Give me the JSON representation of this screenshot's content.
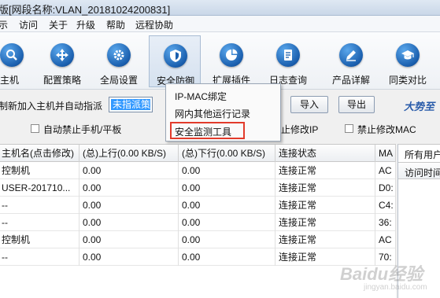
{
  "window": {
    "title": "版[网段名称:VLAN_20181024200831]"
  },
  "menu": [
    "示",
    "访问",
    "关于",
    "升级",
    "帮助",
    "远程协助"
  ],
  "toolbar": [
    {
      "label": "主机",
      "icon": "search-icon"
    },
    {
      "label": "配置策略",
      "icon": "strategy-icon"
    },
    {
      "label": "全局设置",
      "icon": "gear-icon"
    },
    {
      "label": "安全防御",
      "icon": "shield-icon"
    },
    {
      "label": "扩展插件",
      "icon": "pie-chart-icon"
    },
    {
      "label": "日志查询",
      "icon": "log-icon"
    },
    {
      "label": "产品详解",
      "icon": "pen-icon"
    },
    {
      "label": "同类对比",
      "icon": "graduation-cap-icon"
    }
  ],
  "filter": {
    "auto_assign_label": "制新加入主机并自动指派",
    "combo_value": "未指派策",
    "import_label": "导入",
    "export_label": "导出",
    "slogan": "大势至",
    "block_phone_label": "自动禁止手机/平板",
    "block_ip_label": "止修改IP",
    "block_mac_label": "禁止修改MAC"
  },
  "dropdown": {
    "items": [
      "IP-MAC绑定",
      "网内其他运行记录",
      "安全监测工具"
    ]
  },
  "table": {
    "columns": [
      "主机名(点击修改)",
      "(总)上行(0.00 KB/S)",
      "(总)下行(0.00 KB/S)",
      "连接状态",
      "MA"
    ],
    "rows": [
      [
        "控制机",
        "0.00",
        "0.00",
        "连接正常",
        "AC"
      ],
      [
        "USER-201710...",
        "0.00",
        "0.00",
        "连接正常",
        "D0:"
      ],
      [
        "--",
        "0.00",
        "0.00",
        "连接正常",
        "C4:"
      ],
      [
        "--",
        "0.00",
        "0.00",
        "连接正常",
        "36:"
      ],
      [
        "控制机",
        "0.00",
        "0.00",
        "连接正常",
        "AC"
      ],
      [
        "--",
        "0.00",
        "0.00",
        "连接正常",
        "70:"
      ]
    ]
  },
  "side_panel": {
    "title": "所有用户",
    "column": "访问时间"
  },
  "watermark": {
    "brand": "Baidu经验",
    "url": "jingyan.baidu.com"
  }
}
